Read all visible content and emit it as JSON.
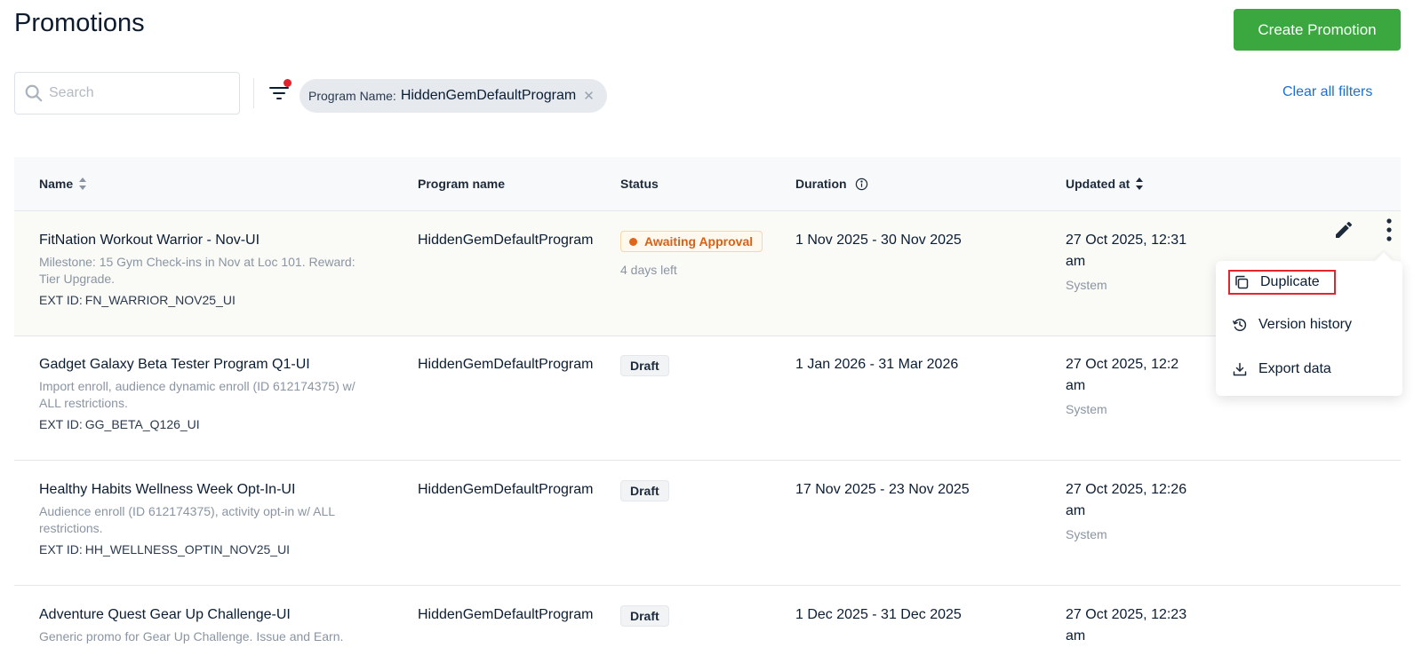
{
  "header": {
    "title": "Promotions",
    "create_label": "Create Promotion",
    "create_color": "#3aa73f"
  },
  "toolbar": {
    "search_placeholder": "Search",
    "filter_icon": "filter-icon",
    "active_filter": {
      "key": "Program Name:",
      "value": "HiddenGemDefaultProgram",
      "remove_icon": "close-icon"
    },
    "clear_label": "Clear all filters"
  },
  "table": {
    "columns": {
      "name": "Name",
      "program": "Program name",
      "status": "Status",
      "duration": "Duration",
      "updated": "Updated at"
    },
    "rows": [
      {
        "name": "FitNation Workout Warrior - Nov-UI",
        "description": "Milestone: 15 Gym Check-ins in Nov at Loc 101. Reward: Tier Upgrade.",
        "ext_label": "EXT ID:",
        "ext_id": "FN_WARRIOR_NOV25_UI",
        "program": "HiddenGemDefaultProgram",
        "status": "Awaiting Approval",
        "status_sub": "4 days left",
        "duration": "1 Nov 2025 - 30 Nov 2025",
        "updated": "27 Oct 2025, 12:31 am",
        "updated_by": "System"
      },
      {
        "name": "Gadget Galaxy Beta Tester Program Q1-UI",
        "description": "Import enroll, audience dynamic enroll (ID 612174375) w/ ALL restrictions.",
        "ext_label": "EXT ID:",
        "ext_id": "GG_BETA_Q126_UI",
        "program": "HiddenGemDefaultProgram",
        "status": "Draft",
        "duration": "1 Jan 2026 - 31 Mar 2026",
        "updated": "27 Oct 2025, 12:2",
        "updated_line2": "am",
        "updated_by": "System"
      },
      {
        "name": "Healthy Habits Wellness Week Opt-In-UI",
        "description": "Audience enroll (ID 612174375), activity opt-in w/ ALL restrictions.",
        "ext_label": "EXT ID:",
        "ext_id": "HH_WELLNESS_OPTIN_NOV25_UI",
        "program": "HiddenGemDefaultProgram",
        "status": "Draft",
        "duration": "17 Nov 2025 - 23 Nov 2025",
        "updated": "27 Oct 2025, 12:26 am",
        "updated_by": "System"
      },
      {
        "name": "Adventure Quest Gear Up Challenge-UI",
        "description": "Generic promo for Gear Up Challenge. Issue and Earn.",
        "program": "HiddenGemDefaultProgram",
        "status": "Draft",
        "duration": "1 Dec 2025 - 31 Dec 2025",
        "updated": "27 Oct 2025, 12:23 am"
      }
    ]
  },
  "row_actions": {
    "edit_icon": "pencil-icon",
    "more_icon": "more-vertical-icon"
  },
  "menu": {
    "items": [
      {
        "label": "Duplicate",
        "icon": "copy-icon"
      },
      {
        "label": "Version history",
        "icon": "history-icon"
      },
      {
        "label": "Export data",
        "icon": "download-icon"
      }
    ]
  }
}
